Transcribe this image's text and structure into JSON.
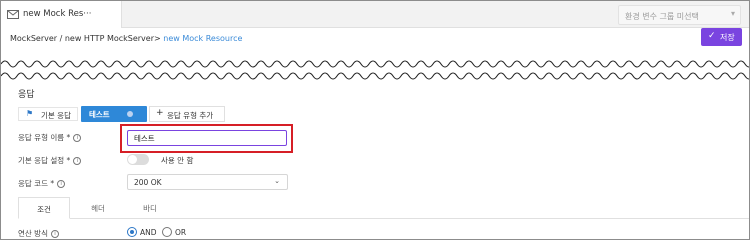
{
  "tab": {
    "title": "new Mock Res···"
  },
  "env_select": {
    "placeholder": "환경 변수 그룹 미선택"
  },
  "breadcrumb": {
    "path": "MockServer / new HTTP MockServer> ",
    "current": "new Mock Resource"
  },
  "toolbar": {
    "save_label": "저장"
  },
  "response": {
    "section_title": "응답",
    "tabs": [
      {
        "label": "기본 응답"
      },
      {
        "label": "테스트"
      }
    ],
    "add_tab_label": "응답 유형 추가"
  },
  "form": {
    "name_label": "응답 유형 이름 *",
    "name_value": "테스트",
    "default_label": "기본 응답 설정 *",
    "default_toggle_text": "사용 안 함",
    "default_enabled": false,
    "code_label": "응답 코드 *",
    "code_value": "200 OK"
  },
  "content_tabs": [
    {
      "label": "조건"
    },
    {
      "label": "헤더"
    },
    {
      "label": "바디"
    }
  ],
  "condition": {
    "operator_label": "연산 방식",
    "options": [
      {
        "label": "AND",
        "selected": true
      },
      {
        "label": "OR",
        "selected": false
      }
    ]
  },
  "colors": {
    "accent": "#7a44e0",
    "primary": "#2e88d8",
    "highlight": "#d61f26"
  }
}
